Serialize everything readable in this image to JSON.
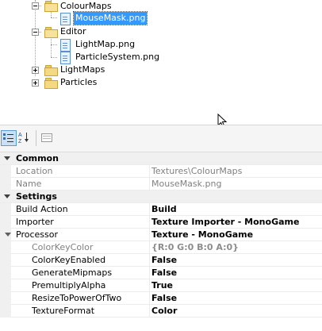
{
  "tree": {
    "items": [
      {
        "label": "ColourMaps",
        "type": "folder-open"
      },
      {
        "label": "MouseMask.png",
        "type": "file",
        "selected": true
      },
      {
        "label": "Editor",
        "type": "folder-open"
      },
      {
        "label": "LightMap.png",
        "type": "file"
      },
      {
        "label": "ParticleSystem.png",
        "type": "file"
      },
      {
        "label": "LightMaps",
        "type": "folder"
      },
      {
        "label": "Particles",
        "type": "folder"
      }
    ]
  },
  "toolbar": {
    "categorized_icon": "categorized-icon",
    "alphabetical_icon": "alphabetical-icon",
    "property_pages_icon": "property-pages-icon"
  },
  "properties": {
    "common": {
      "title": "Common",
      "rows": [
        {
          "name": "Location",
          "value": "Textures\\ColourMaps"
        },
        {
          "name": "Name",
          "value": "MouseMask.png"
        }
      ]
    },
    "settings": {
      "title": "Settings",
      "rows": [
        {
          "name": "Build Action",
          "value": "Build"
        },
        {
          "name": "Importer",
          "value": "Texture Importer - MonoGame"
        },
        {
          "name": "Processor",
          "value": "Texture - MonoGame"
        }
      ],
      "processor_params": [
        {
          "name": "ColorKeyColor",
          "value": "{R:0 G:0 B:0 A:0}"
        },
        {
          "name": "ColorKeyEnabled",
          "value": "False"
        },
        {
          "name": "GenerateMipmaps",
          "value": "False"
        },
        {
          "name": "PremultiplyAlpha",
          "value": "True"
        },
        {
          "name": "ResizeToPowerOfTwo",
          "value": "False"
        },
        {
          "name": "TextureFormat",
          "value": "Color"
        }
      ]
    }
  },
  "colors": {
    "selection": "#3399ff",
    "category_bg": "#f0f0f0"
  }
}
